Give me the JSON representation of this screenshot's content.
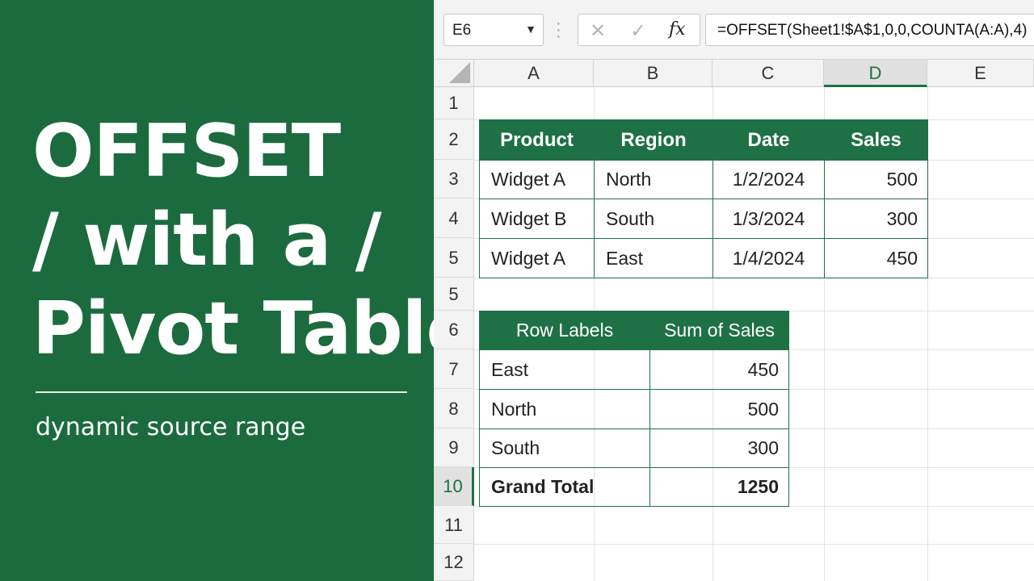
{
  "banner": {
    "title_line1": "OFFSET",
    "title_line2": "/ with a /",
    "title_line3": "Pivot Table",
    "subtitle": "dynamic source range"
  },
  "formula_bar": {
    "name_box": "E6",
    "fx_label": "fx",
    "formula": "=OFFSET(Sheet1!$A$1,0,0,COUNTA(A:A),4)"
  },
  "columns": [
    "A",
    "B",
    "C",
    "D",
    "E"
  ],
  "selected_column": "D",
  "rows": [
    "1",
    "2",
    "3",
    "4",
    "5",
    "5",
    "6",
    "7",
    "8",
    "9",
    "10",
    "11",
    "12"
  ],
  "selected_row": "10",
  "source_table": {
    "headers": [
      "Product",
      "Region",
      "Date",
      "Sales"
    ],
    "rows": [
      [
        "Widget A",
        "North",
        "1/2/2024",
        "500"
      ],
      [
        "Widget B",
        "South",
        "1/3/2024",
        "300"
      ],
      [
        "Widget A",
        "East",
        "1/4/2024",
        "450"
      ]
    ]
  },
  "pivot_table": {
    "headers": [
      "Row Labels",
      "Sum of Sales"
    ],
    "rows": [
      [
        "East",
        "450"
      ],
      [
        "North",
        "500"
      ],
      [
        "South",
        "300"
      ]
    ],
    "total": [
      "Grand Total",
      "1250"
    ]
  },
  "colors": {
    "banner_green": "#1b6b3e",
    "header_green": "#1e7145"
  }
}
